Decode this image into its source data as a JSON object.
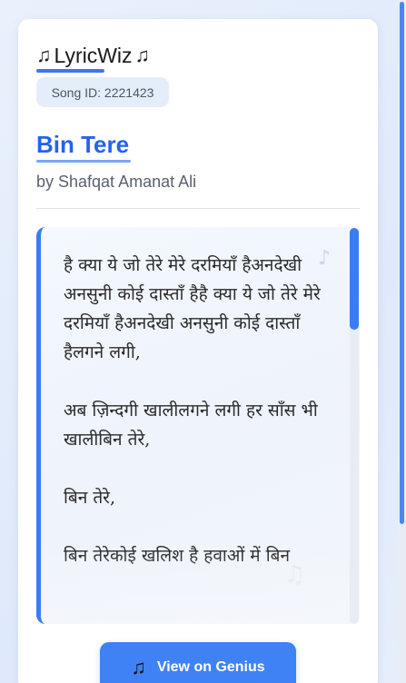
{
  "brand": {
    "name": "LyricWiz",
    "icon_left": "♫",
    "icon_right": "♫"
  },
  "song": {
    "id_label": "Song ID: 2221423",
    "title": "Bin Tere",
    "artist": "by Shafqat Amanat Ali"
  },
  "lyrics": {
    "text": "है क्या ये जो तेरे मेरे दरमियाँ हैअनदेखी अनसुनी कोई दास्ताँ हैहै क्या ये जो तेरे मेरे दरमियाँ हैअनदेखी अनसुनी कोई दास्ताँ हैलगने लगी,\n\nअब ज़िन्दगी खालीलगने लगी हर साँस भी खालीबिन तेरे,\n\nबिन तेरे,\n\nबिन तेरेकोई खलिश है हवाओं में बिन"
  },
  "actions": {
    "genius_label": "View on Genius",
    "genius_icon": "♫"
  },
  "colors": {
    "accent": "#2563eb",
    "button": "#3f82f5",
    "lyrics_border": "#3b7cf5"
  }
}
